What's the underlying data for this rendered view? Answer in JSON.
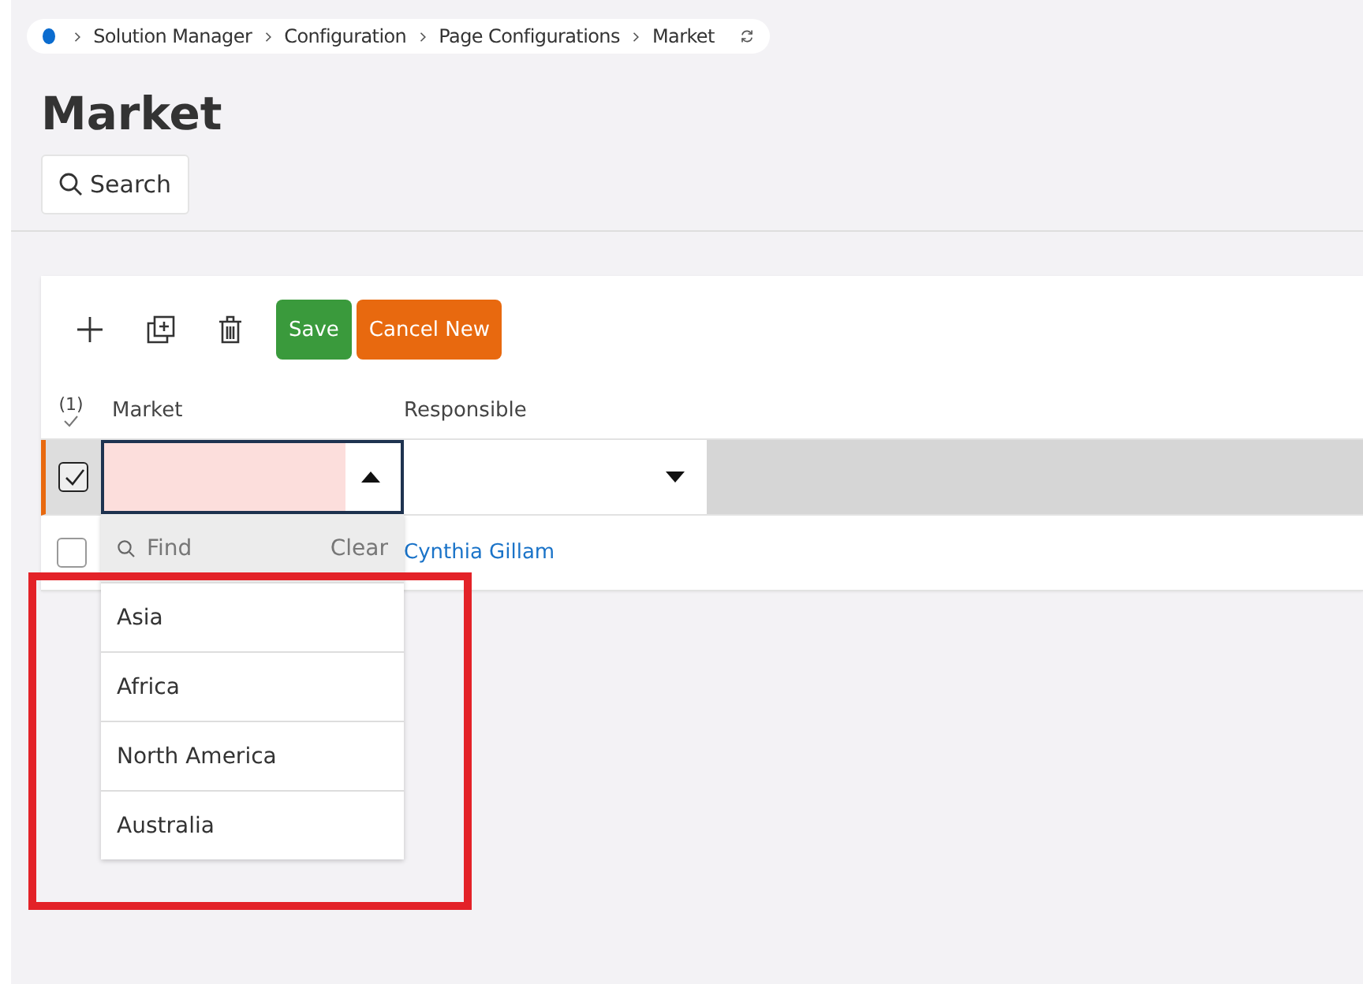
{
  "breadcrumb": {
    "items": [
      "Solution Manager",
      "Configuration",
      "Page Configurations",
      "Market"
    ]
  },
  "title": "Market",
  "search_button": "Search",
  "toolbar": {
    "buttons": [
      {
        "label": "Save",
        "kind": "save"
      },
      {
        "label": "Cancel New",
        "kind": "cancel"
      }
    ]
  },
  "table": {
    "selection_count": "(1)",
    "columns": [
      "Market",
      "Responsible"
    ],
    "rows": [
      {
        "kind": "editor",
        "checked": true,
        "market_invalid": true
      },
      {
        "kind": "data",
        "checked": false,
        "responsible": "Cynthia Gillam"
      }
    ]
  },
  "dropdown": {
    "placeholder": "Find",
    "clear": "Clear",
    "options": [
      "Asia",
      "Africa",
      "North America",
      "Australia"
    ]
  },
  "annotation": {
    "color": "#e32228"
  }
}
